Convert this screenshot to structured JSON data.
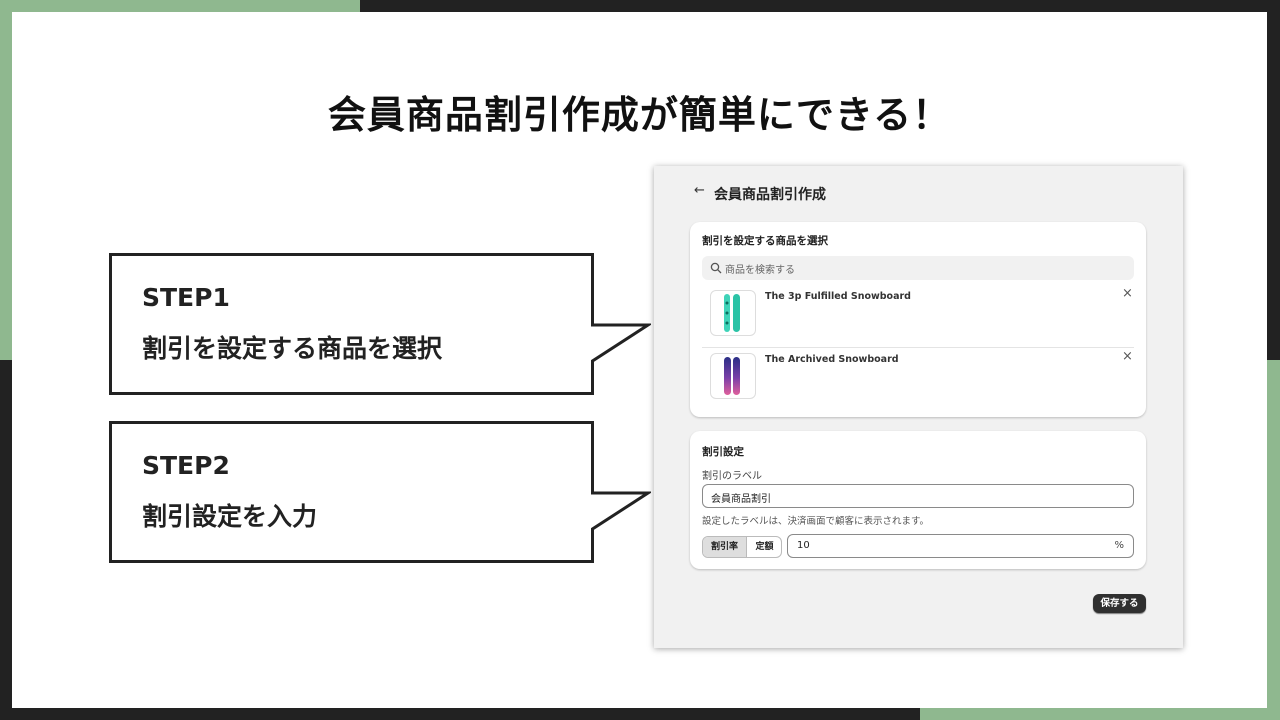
{
  "slide": {
    "title": "会員商品割引作成が簡単にできる！"
  },
  "callouts": [
    {
      "step": "STEP1",
      "description": "割引を設定する商品を選択"
    },
    {
      "step": "STEP2",
      "description": "割引設定を入力"
    }
  ],
  "ui": {
    "back_icon": "←",
    "title": "会員商品割引作成",
    "product_card": {
      "title": "割引を設定する商品を選択",
      "search_placeholder": "商品を検索する",
      "products": [
        {
          "name": "The 3p Fulfilled Snowboard",
          "remove_icon": "×"
        },
        {
          "name": "The Archived Snowboard",
          "remove_icon": "×"
        }
      ]
    },
    "discount_card": {
      "title": "割引設定",
      "label_field_label": "割引のラベル",
      "label_value": "会員商品割引",
      "help_text": "設定したラベルは、決済画面で顧客に表示されます。",
      "type_options": [
        "割引率",
        "定額"
      ],
      "selected_type": "割引率",
      "amount_value": "10",
      "amount_suffix": "%"
    },
    "save_label": "保存する"
  },
  "colors": {
    "frame_dark": "#222222",
    "accent_green": "#8fb88f",
    "save_button": "#303030"
  }
}
